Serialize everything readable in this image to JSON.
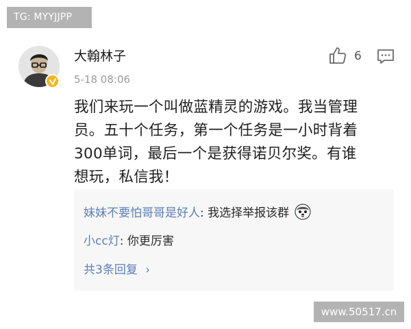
{
  "watermarks": {
    "top": "TG: MYYJJPP",
    "bottom": "www.50517.cn"
  },
  "post": {
    "username": "大翰林子",
    "timestamp": "5-18 08:06",
    "like_count": "6",
    "text_lines": [
      "我们来玩一个叫做蓝精灵的游戏。我当管理",
      "员。五十个任务，第一个任务是一小时背着",
      "300单词，最后一个是获得诺贝尔奖。有谁",
      "想玩，私信我！"
    ]
  },
  "replies": [
    {
      "author": "妹妹不要怕哥哥是好人",
      "separator": ": ",
      "text": "我选择举报该群",
      "emoji": "husky-face-emoji"
    },
    {
      "author": "小cc灯",
      "separator": ": ",
      "text": "你更厉害"
    }
  ],
  "more_replies": {
    "label": "共3条回复",
    "chevron": "›"
  },
  "icons": {
    "like": "thumbs-up-icon",
    "comment": "comment-icon",
    "verified": "verified-badge-icon"
  },
  "colors": {
    "link_blue": "#5b7fb8",
    "verified_gold": "#f5b51f",
    "timestamp_gray": "#9a9a9a"
  }
}
